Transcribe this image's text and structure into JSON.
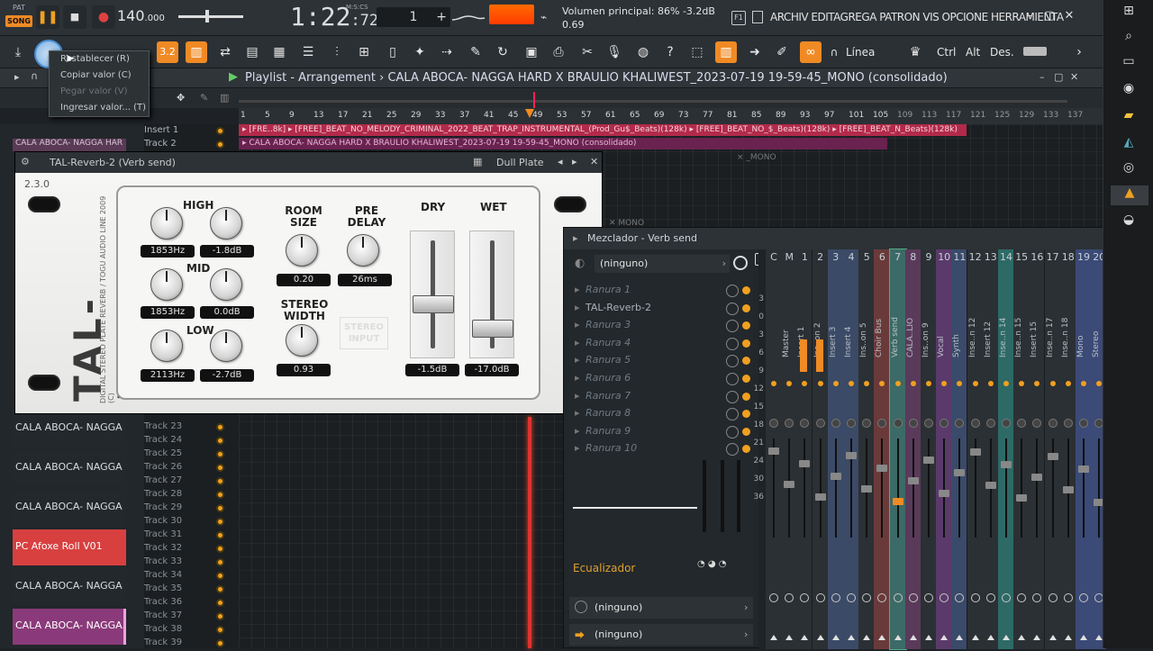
{
  "topbar": {
    "pat_label": "PAT",
    "song_label": "SONG",
    "play_icon": "pause-icon",
    "tempo": "140",
    "tempo_decimal": ".000",
    "time": "1:22",
    "time_frac": ":72",
    "time_unit": "M:S:CS",
    "pattern_number": "1",
    "plus": "+",
    "volume_text": "Volumen principal: 86%  -3.2dB",
    "volume_sub": "0.69",
    "f1_label": "F1",
    "menus": "ARCHIV EDITAGREGA PATRON VIS OPCIONE HERRAMIENTA",
    "minimize": "–",
    "maximize": "▢",
    "close": "✕"
  },
  "toolbar": {
    "snap_label": "Línea",
    "ctrl": "Ctrl",
    "alt": "Alt",
    "des": "Des."
  },
  "context_menu": {
    "items": [
      {
        "label": "Restablecer (R)",
        "enabled": true
      },
      {
        "label": "Copiar valor (C)",
        "enabled": true
      },
      {
        "label": "Pegar valor (V)",
        "enabled": false
      },
      {
        "label": "Ingresar valor... (T)",
        "enabled": true
      }
    ]
  },
  "playlist": {
    "title": "Playlist - Arrangement",
    "separator": "›",
    "project": "CALA ABOCA- NAGGA HARD X BRAULIO KHALIWEST_2023-07-19 19-59-45_MONO (consolidado)",
    "ruler": [
      "1",
      "5",
      "9",
      "13",
      "17",
      "21",
      "25",
      "29",
      "33",
      "37",
      "41",
      "45",
      "49",
      "53",
      "57",
      "61",
      "65",
      "69",
      "73",
      "77",
      "81",
      "85",
      "89",
      "93",
      "97",
      "101",
      "105",
      "109",
      "113",
      "117",
      "121",
      "125",
      "129",
      "133",
      "137"
    ],
    "top_tracks": [
      "Insert 1",
      "Track 2"
    ],
    "clip_row1": "▸ [FRE..8k] ▸ [FREE]_BEAT_NO_MELODY_CRIMINAL_2022_BEAT_TRAP_INSTRUMENTAL_(Prod_Gu$_Beats)(128k) ▸ [FREE]_BEAT_NO_$_Beats)(128k)  ▸ [FREE]_BEAT_N_Beats)(128k)",
    "clip_row2": "▸ CALA ABOCA- NAGGA HARD X BRAULIO KHALIWEST_2023-07-19 19-59-45_MONO (consolidado)",
    "ghost_clip": "× _MONO",
    "ghost_clip2": "✕ MONO",
    "tracks": [
      "Track 23",
      "Track 24",
      "Track 25",
      "Track 26",
      "Track 27",
      "Track 28",
      "Track 29",
      "Track 30",
      "Track 31",
      "Track 32",
      "Track 33",
      "Track 34",
      "Track 35",
      "Track 36",
      "Track 37",
      "Track 38",
      "Track 39"
    ],
    "left_clips": [
      "CALA ABOCA- NAGGA HAR...",
      "CALA ABOCA- NAGGA HAR...",
      "CALA ABOCA- NAGGA HAR...",
      "PC Afoxe Roll V01",
      "CALA ABOCA- NAGGA HAR...",
      "CALA ABOCA- NAGGA..."
    ],
    "left_top_clip": "CALA ABOCA- NAGGA HAR"
  },
  "reverb": {
    "window_title": "TAL-Reverb-2 (Verb send)",
    "preset": "Dull Plate",
    "version": "2.3.0",
    "brand": "TAL-REVERB",
    "brand_sub": "DIGITAL STEREO PLATE REVERB / TOGU AUDIO LINE 2009 (C)",
    "labels": {
      "high": "HIGH",
      "mid": "MID",
      "low": "LOW",
      "room_size": "ROOM SIZE",
      "pre_delay": "PRE DELAY",
      "stereo_width": "STEREO WIDTH",
      "stereo_input": "STEREO INPUT",
      "dry": "DRY",
      "wet": "WET"
    },
    "values": {
      "high_freq": "1853Hz",
      "high_gain": "-1.8dB",
      "mid_freq": "1853Hz",
      "mid_gain": "0.0dB",
      "low_freq": "2113Hz",
      "low_gain": "-2.7dB",
      "room_size": "0.20",
      "pre_delay": "26ms",
      "stereo_width": "0.93",
      "dry": "-1.5dB",
      "wet": "-17.0dB"
    },
    "dry_level": 0.45,
    "wet_level": 0.2
  },
  "mixer": {
    "title": "Mezclador - Verb send",
    "input": "(ninguno)",
    "slots": [
      "Ranura 1",
      "TAL-Reverb-2",
      "Ranura 3",
      "Ranura 4",
      "Ranura 5",
      "Ranura 6",
      "Ranura 7",
      "Ranura 8",
      "Ranura 9",
      "Ranura 10"
    ],
    "eq_label": "Ecualizador",
    "out1": "(ninguno)",
    "out2": "(ninguno)",
    "meter_scale": [
      "3",
      "0",
      "3",
      "6",
      "9",
      "12",
      "15",
      "18",
      "21",
      "24",
      "30",
      "36"
    ],
    "strips": [
      {
        "num": "C",
        "name": "",
        "color": "#2b3034"
      },
      {
        "num": "M",
        "name": "Master",
        "color": "#2b3034"
      },
      {
        "num": "1",
        "name": "Insert 1",
        "color": "#2b3034"
      },
      {
        "num": "2",
        "name": "Ins..on 2",
        "color": "#2b3034"
      },
      {
        "num": "3",
        "name": "Insert 3",
        "color": "#3b4a66"
      },
      {
        "num": "4",
        "name": "Insert 4",
        "color": "#3b4a66"
      },
      {
        "num": "5",
        "name": "Ins..on 5",
        "color": "#2b3034"
      },
      {
        "num": "6",
        "name": "Choir Bus",
        "color": "#6a3a3a"
      },
      {
        "num": "7",
        "name": "Verb send",
        "color": "#3c6a66"
      },
      {
        "num": "8",
        "name": "CALA..LIO",
        "color": "#5a3a5a"
      },
      {
        "num": "9",
        "name": "Ins..on 9",
        "color": "#2b3034"
      },
      {
        "num": "10",
        "name": "Vocal",
        "color": "#5a3a6a"
      },
      {
        "num": "11",
        "name": "Synth",
        "color": "#3a4a6a"
      },
      {
        "num": "12",
        "name": "Inse..n 12",
        "color": "#2b3034"
      },
      {
        "num": "13",
        "name": "Insert 12",
        "color": "#2b3034"
      },
      {
        "num": "14",
        "name": "Inse..n 14",
        "color": "#2d6a66"
      },
      {
        "num": "15",
        "name": "Inse..n 15",
        "color": "#2b3034"
      },
      {
        "num": "16",
        "name": "Insert 15",
        "color": "#2b3034"
      },
      {
        "num": "17",
        "name": "Inse..n 17",
        "color": "#2b3034"
      },
      {
        "num": "18",
        "name": "Inse..n 18",
        "color": "#2b3034"
      },
      {
        "num": "19",
        "name": "Mono",
        "color": "#3b4a76"
      },
      {
        "num": "20",
        "name": "Stereo",
        "color": "#3b4a76"
      }
    ]
  }
}
